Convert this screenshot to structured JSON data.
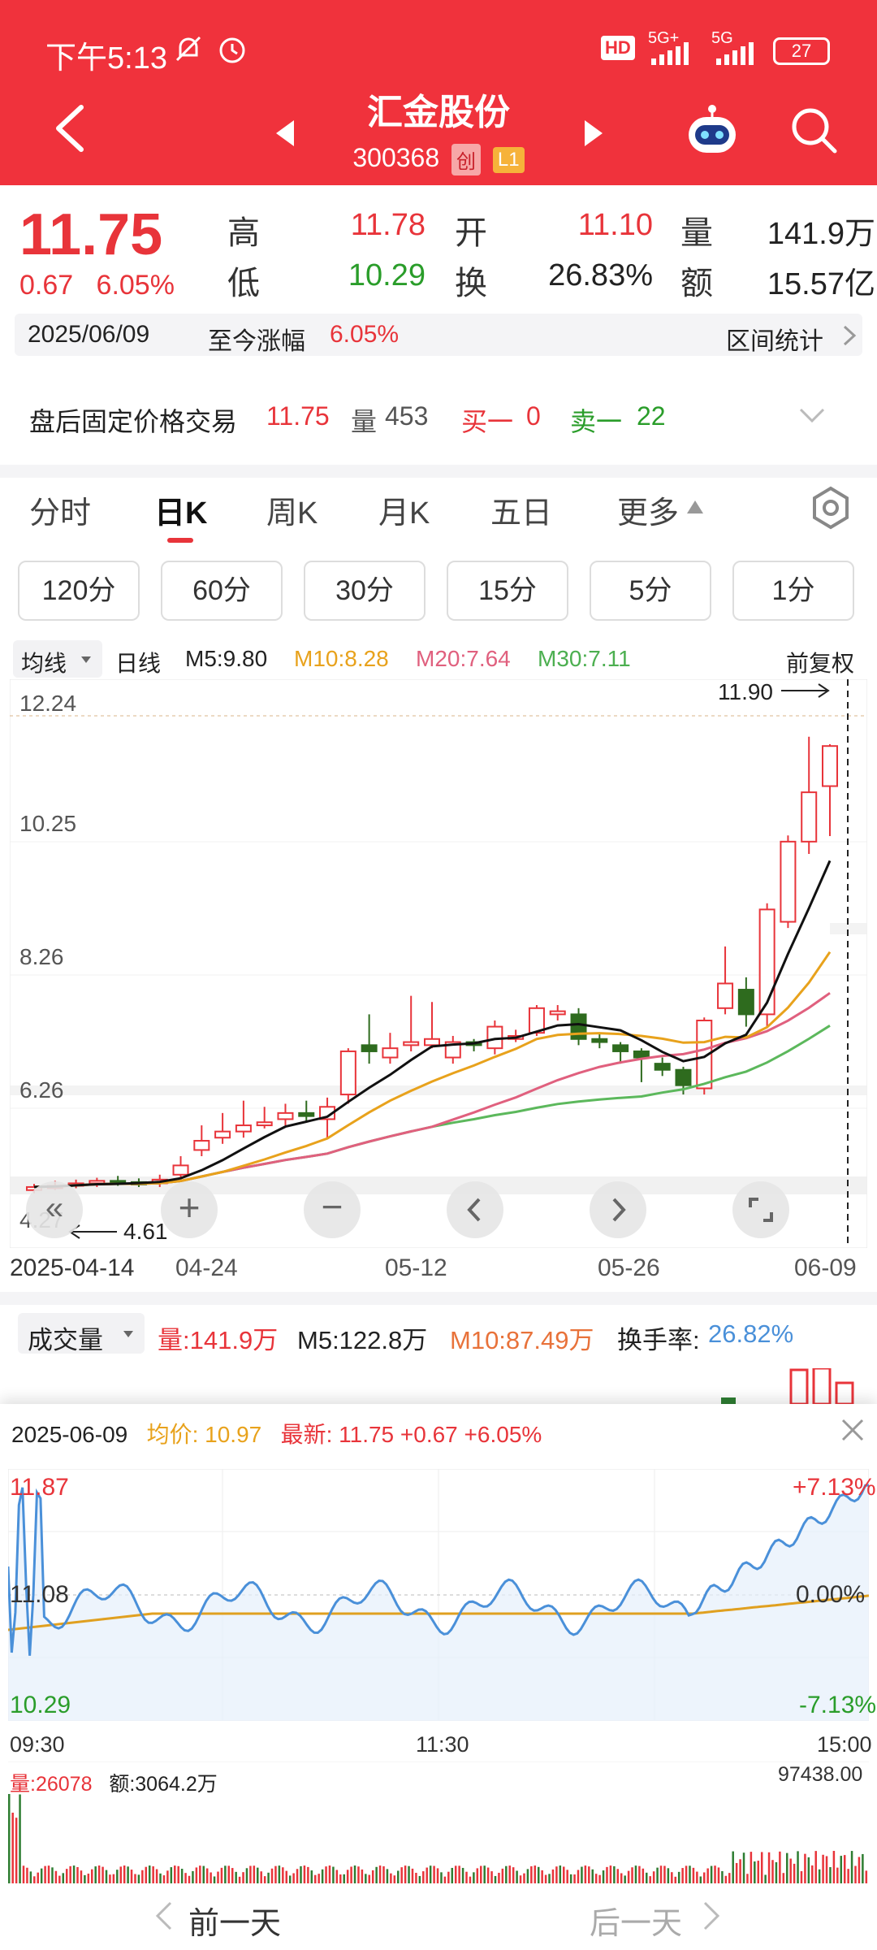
{
  "status": {
    "time": "下午5:13",
    "battery": "27",
    "net1": "5G+",
    "net2": "5G",
    "hd": "HD"
  },
  "header": {
    "title": "汇金股份",
    "code": "300368",
    "tag1": "创",
    "tag2": "L1"
  },
  "quote": {
    "price": "11.75",
    "change": "0.67",
    "change_pct": "6.05%",
    "high_label": "高",
    "high": "11.78",
    "open_label": "开",
    "open": "11.10",
    "vol_label": "量",
    "vol": "141.9万",
    "low_label": "低",
    "low": "10.29",
    "turn_label": "换",
    "turn": "26.83%",
    "amt_label": "额",
    "amt": "15.57亿"
  },
  "range": {
    "date": "2025/06/09",
    "label": "至今涨幅",
    "pct": "6.05%",
    "stat": "区间统计"
  },
  "after_hours": {
    "label": "盘后固定价格交易",
    "price": "11.75",
    "vol_label": "量",
    "vol": "453",
    "buy_label": "买一",
    "buy": "0",
    "sell_label": "卖一",
    "sell": "22"
  },
  "tabs": [
    "分时",
    "日K",
    "周K",
    "月K",
    "五日",
    "更多"
  ],
  "intervals": [
    "120分",
    "60分",
    "30分",
    "15分",
    "5分",
    "1分"
  ],
  "ma": {
    "dropdown": "均线",
    "line": "日线",
    "m5": "M5:9.80",
    "m10": "M10:8.28",
    "m20": "M20:7.64",
    "m30": "M30:7.11",
    "adjust": "前复权"
  },
  "kline": {
    "y_labels": [
      "12.24",
      "10.25",
      "8.26",
      "6.26",
      "4.27"
    ],
    "max_label": "11.90",
    "min_label": "4.61",
    "dates": [
      "2025-04-14",
      "04-24",
      "05-12",
      "05-26",
      "06-09"
    ]
  },
  "volume": {
    "label": "成交量",
    "vol": "量:141.9万",
    "m5": "M5:122.8万",
    "m10": "M10:87.49万",
    "turn_label": "换手率:",
    "turn": "26.82%"
  },
  "intraday": {
    "date": "2025-06-09",
    "avg_label": "均价:",
    "avg": "10.97",
    "last_label": "最新:",
    "last": "11.75",
    "chg": "+0.67",
    "pct": "+6.05%",
    "top": "11.87",
    "mid": "11.08",
    "bot": "10.29",
    "top_pct": "+7.13%",
    "mid_pct": "0.00%",
    "bot_pct": "-7.13%",
    "t_start": "09:30",
    "t_mid": "11:30",
    "t_end": "15:00",
    "vol_label": "量:",
    "vol": "26078",
    "amt_label": "额:",
    "amt": "3064.2万",
    "vol_max": "97438.00"
  },
  "nav": {
    "prev": "前一天",
    "next": "后一天"
  }
}
